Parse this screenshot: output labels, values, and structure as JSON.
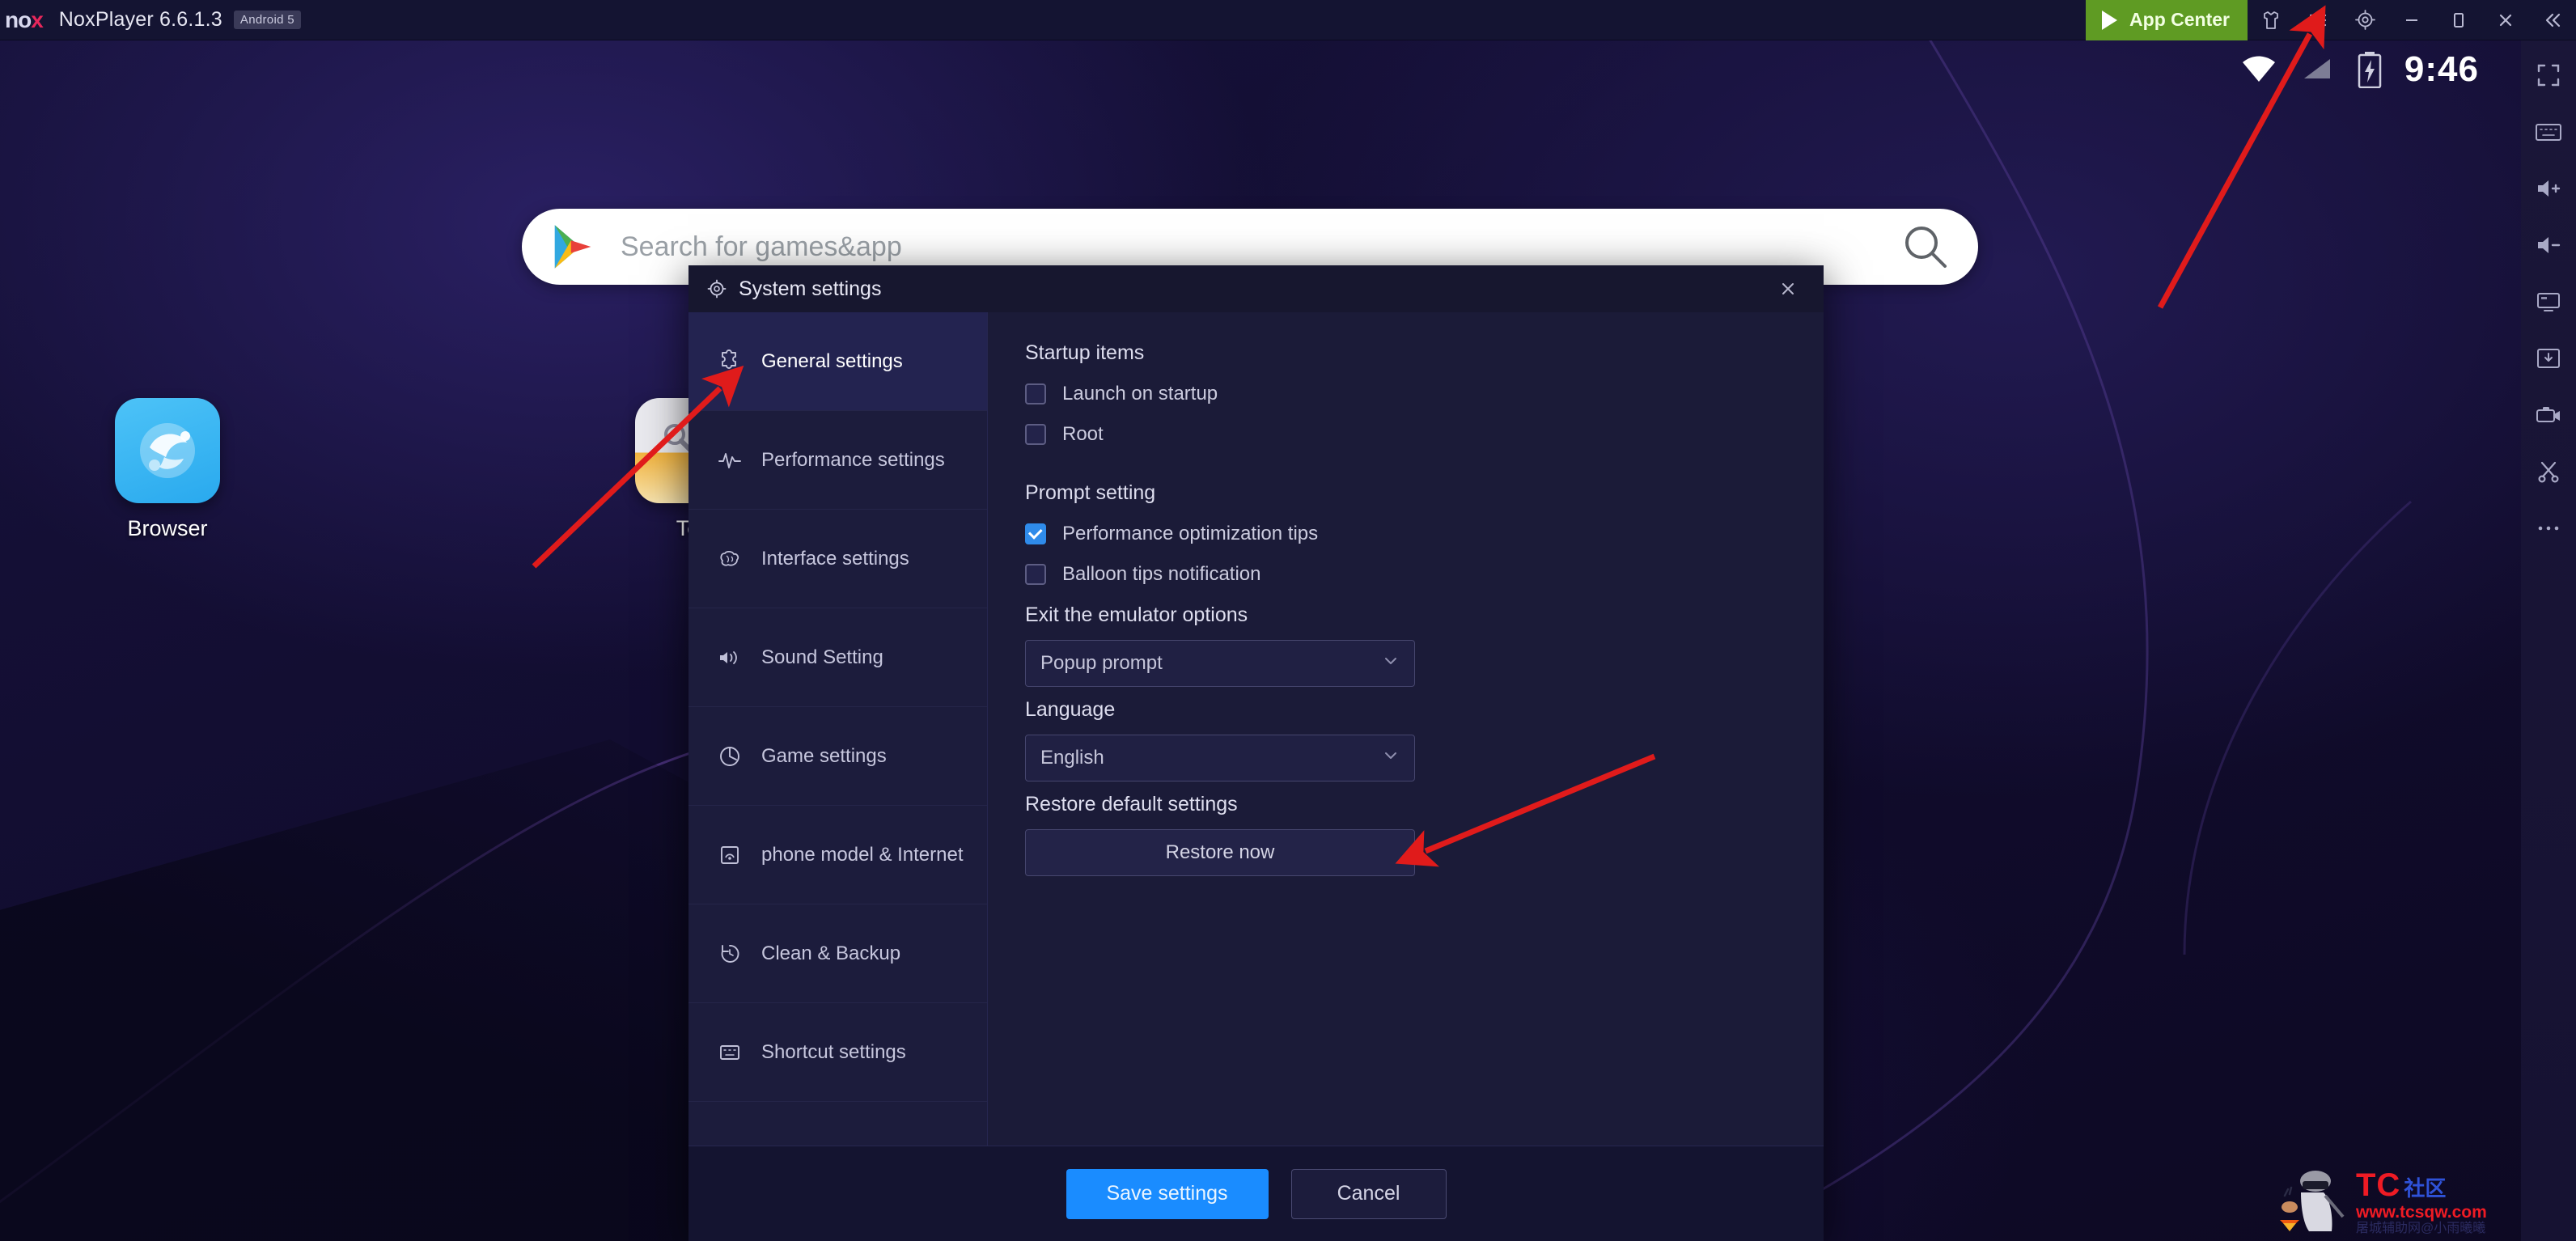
{
  "titlebar": {
    "logo": "nox",
    "app_title": "NoxPlayer 6.6.1.3",
    "android_badge": "Android 5",
    "app_center_label": "App Center",
    "icons": {
      "app_center": "play-icon",
      "skin": "shirt-icon",
      "menu": "hamburger-menu-icon",
      "settings": "gear-icon",
      "minimize": "minimize-icon",
      "maximize": "maximize-icon",
      "close": "close-icon",
      "collapse": "double-chevron-left-icon"
    }
  },
  "statusbar": {
    "wifi_icon": "wifi-icon",
    "signal_icon": "signal-icon",
    "battery_icon": "battery-charging-icon",
    "time": "9:46"
  },
  "toolcolumn": {
    "items": [
      {
        "name": "fullscreen-icon",
        "label": "Fullscreen"
      },
      {
        "name": "keyboard-icon",
        "label": "Keyboard"
      },
      {
        "name": "volume-up-icon",
        "label": "Volume up"
      },
      {
        "name": "volume-down-icon",
        "label": "Volume down"
      },
      {
        "name": "screenshot-icon",
        "label": "Screenshot"
      },
      {
        "name": "apk-install-icon",
        "label": "Install APK"
      },
      {
        "name": "video-record-icon",
        "label": "Record"
      },
      {
        "name": "scissors-icon",
        "label": "Cut"
      },
      {
        "name": "more-icon",
        "label": "More"
      }
    ]
  },
  "search": {
    "placeholder": "Search for games&app",
    "play_icon": "google-play-icon",
    "search_icon": "magnifier-icon"
  },
  "desktop": {
    "icons": [
      {
        "name": "browser",
        "label": "Browser"
      },
      {
        "name": "tools",
        "label": "To"
      }
    ]
  },
  "dialog": {
    "title": "System settings",
    "title_icon": "gear-icon",
    "close_icon": "close-icon",
    "sidebar": [
      {
        "label": "General settings",
        "icon": "puzzle-icon",
        "active": true
      },
      {
        "label": "Performance settings",
        "icon": "activity-pulse-icon",
        "active": false
      },
      {
        "label": "Interface settings",
        "icon": "brain-icon",
        "active": false
      },
      {
        "label": "Sound Setting",
        "icon": "sound-wave-icon",
        "active": false
      },
      {
        "label": "Game settings",
        "icon": "gamepad-icon",
        "active": false
      },
      {
        "label": "phone model & Internet",
        "icon": "phone-icon",
        "active": false
      },
      {
        "label": "Clean & Backup",
        "icon": "history-restore-icon",
        "active": false
      },
      {
        "label": "Shortcut settings",
        "icon": "keyboard-shortcut-icon",
        "active": false
      }
    ],
    "panel": {
      "startup": {
        "title": "Startup items",
        "options": [
          {
            "label": "Launch on startup",
            "checked": false
          },
          {
            "label": "Root",
            "checked": false
          }
        ]
      },
      "prompt": {
        "title": "Prompt setting",
        "options": [
          {
            "label": "Performance optimization tips",
            "checked": true
          },
          {
            "label": "Balloon tips notification",
            "checked": false
          }
        ]
      },
      "exit_options": {
        "label": "Exit the emulator options",
        "value": "Popup prompt",
        "chevron_icon": "chevron-down-icon"
      },
      "language": {
        "label": "Language",
        "value": "English",
        "chevron_icon": "chevron-down-icon"
      },
      "restore": {
        "label": "Restore default settings",
        "button_label": "Restore now"
      }
    },
    "footer": {
      "save_label": "Save settings",
      "cancel_label": "Cancel"
    }
  },
  "watermark": {
    "tc": "TC",
    "cn": "社区",
    "url": "www.tcsqw.com",
    "sub": "屠城辅助网@小雨曦曦"
  },
  "colors": {
    "accent_blue": "#1a8cff",
    "checkbox_blue": "#2f8bea",
    "app_center_green": "#5f9b23",
    "nox_red": "#e8275b",
    "arrow_red": "#e01b1b",
    "dialog_bg": "#1b1b38",
    "sidebar_bg": "#1c1c3c"
  }
}
